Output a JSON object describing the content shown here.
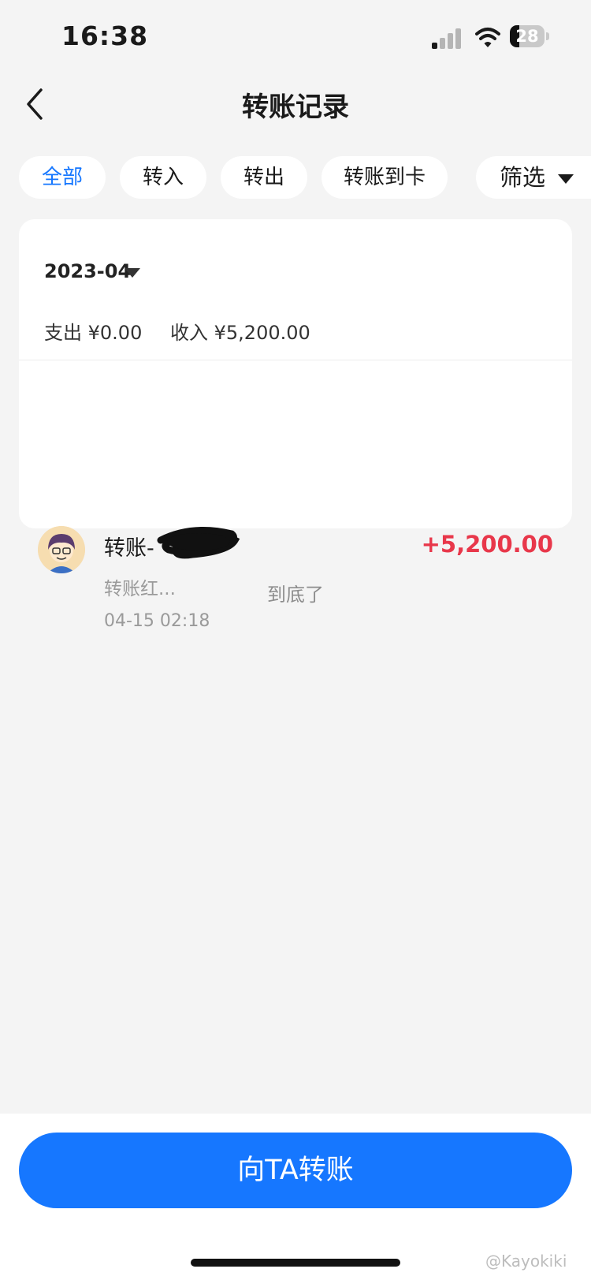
{
  "status_bar": {
    "time": "16:38",
    "battery": "28",
    "icons": [
      "cellular-signal-icon",
      "wifi-icon",
      "battery-icon"
    ]
  },
  "nav": {
    "title": "转账记录",
    "back_icon": "chevron-left-icon"
  },
  "tabs": [
    {
      "label": "全部",
      "active": true
    },
    {
      "label": "转入",
      "active": false
    },
    {
      "label": "转出",
      "active": false
    },
    {
      "label": "转账到卡",
      "active": false
    }
  ],
  "filter": {
    "label": "筛选",
    "icon": "caret-down-icon"
  },
  "record_group": {
    "month": "2023-04",
    "expense_summary": "支出 ¥0.00",
    "income_summary": "收入 ¥5,200.00",
    "items": [
      {
        "name": "转账-",
        "amount": "+5,200.00",
        "memo": "转账红...",
        "datetime": "04-15 02:18"
      }
    ]
  },
  "end_text": "到底了",
  "cta": {
    "label": "向TA转账"
  },
  "watermark": "@Kayokiki",
  "colors": {
    "accent": "#1677ff",
    "income": "#e8374a",
    "background": "#f4f4f4"
  }
}
